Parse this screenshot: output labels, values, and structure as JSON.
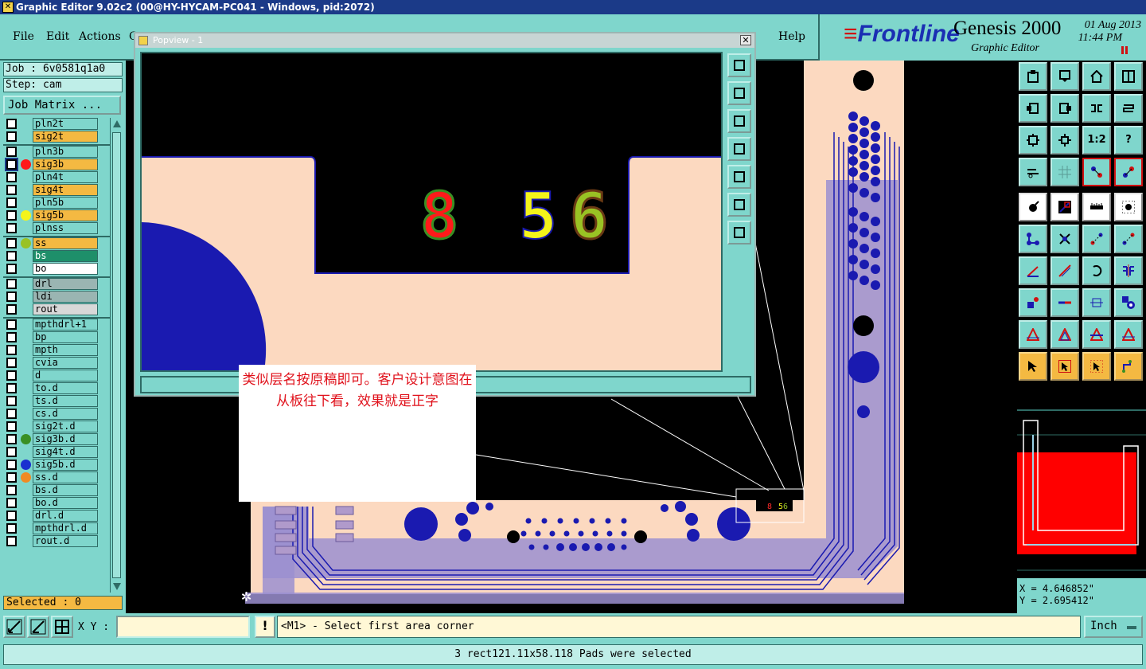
{
  "window": {
    "title": "Graphic Editor 9.02c2 (00@HY-HYCAM-PC041 - Windows, pid:2072)"
  },
  "menu": {
    "items": [
      "File",
      "Edit",
      "Actions",
      "C"
    ],
    "help": "Help"
  },
  "logo": {
    "brand": "Frontline",
    "product": "Genesis 2000",
    "subtitle": "Graphic Editor",
    "date": "01 Aug 2013",
    "time": "11:44 PM"
  },
  "job": {
    "job_label": "Job : 6v0581q1a0",
    "step_label": "Step: cam",
    "matrix_button": "Job Matrix ..."
  },
  "layers": [
    {
      "name": "pln2t",
      "color": "#7fd6cc",
      "dot": ""
    },
    {
      "name": "sig2t",
      "color": "#f4b942",
      "dot": ""
    },
    {
      "name": "pln3b",
      "color": "#7fd6cc",
      "dot": ""
    },
    {
      "name": "sig3b",
      "color": "#f4b942",
      "dot": "#ff1a1a",
      "active": true
    },
    {
      "name": "pln4t",
      "color": "#7fd6cc",
      "dot": ""
    },
    {
      "name": "sig4t",
      "color": "#f4b942",
      "dot": ""
    },
    {
      "name": "pln5b",
      "color": "#7fd6cc",
      "dot": ""
    },
    {
      "name": "sig5b",
      "color": "#f4b942",
      "dot": "#f4f41a"
    },
    {
      "name": "plnss",
      "color": "#7fd6cc",
      "dot": ""
    },
    {
      "name": "ss",
      "color": "#f4b942",
      "dot": "#99c224"
    },
    {
      "name": "bs",
      "color": "#1e8f6a",
      "dot": ""
    },
    {
      "name": "bo",
      "color": "#ffffff",
      "dot": ""
    },
    {
      "name": "drl",
      "color": "#9ab5b2",
      "dot": ""
    },
    {
      "name": "ldi",
      "color": "#9ab5b2",
      "dot": ""
    },
    {
      "name": "rout",
      "color": "#d8d8d8",
      "dot": ""
    },
    {
      "name": "mpthdrl+1",
      "color": "#7fd6cc",
      "dot": ""
    },
    {
      "name": "bp",
      "color": "#7fd6cc",
      "dot": ""
    },
    {
      "name": "mpth",
      "color": "#7fd6cc",
      "dot": ""
    },
    {
      "name": "cvia",
      "color": "#7fd6cc",
      "dot": ""
    },
    {
      "name": "d",
      "color": "#7fd6cc",
      "dot": ""
    },
    {
      "name": "to.d",
      "color": "#7fd6cc",
      "dot": ""
    },
    {
      "name": "ts.d",
      "color": "#7fd6cc",
      "dot": ""
    },
    {
      "name": "cs.d",
      "color": "#7fd6cc",
      "dot": ""
    },
    {
      "name": "sig2t.d",
      "color": "#7fd6cc",
      "dot": ""
    },
    {
      "name": "sig3b.d",
      "color": "#7fd6cc",
      "dot": "#3a8f24"
    },
    {
      "name": "sig4t.d",
      "color": "#7fd6cc",
      "dot": ""
    },
    {
      "name": "sig5b.d",
      "color": "#7fd6cc",
      "dot": "#1a2fd0"
    },
    {
      "name": "ss.d",
      "color": "#7fd6cc",
      "dot": "#f08a24"
    },
    {
      "name": "bs.d",
      "color": "#7fd6cc",
      "dot": ""
    },
    {
      "name": "bo.d",
      "color": "#7fd6cc",
      "dot": ""
    },
    {
      "name": "drl.d",
      "color": "#7fd6cc",
      "dot": ""
    },
    {
      "name": "mpthdrl.d",
      "color": "#7fd6cc",
      "dot": ""
    },
    {
      "name": "rout.d",
      "color": "#7fd6cc",
      "dot": ""
    }
  ],
  "selected": {
    "label": "Selected : 0"
  },
  "popview": {
    "title": "Popview - 1",
    "close": "✕",
    "digits": [
      "8",
      "5",
      "6"
    ]
  },
  "note": {
    "text": "类似层名按原稿即可。客户设计意图在从板往下看，效果就是正字"
  },
  "tools": {
    "row1": [
      "open-icon",
      "save-icon",
      "home-icon",
      "window-icon"
    ],
    "row2": [
      "pan-left-icon",
      "pan-right-icon",
      "swap-icon",
      "flip-icon"
    ],
    "row3": [
      "fit-icon",
      "zoom-icon",
      "scale-icon",
      "help-icon"
    ],
    "row3_label": "1:2",
    "row3_help": "?"
  },
  "coords": {
    "x": "X = 4.646852\"",
    "y": "Y = 2.695412\""
  },
  "command": {
    "xy_label": "X Y :",
    "xy_value": "",
    "excl": "!",
    "prompt": "<M1> - Select first area corner",
    "unit": "Inch"
  },
  "status": {
    "message": "3 rect121.11x58.118 Pads were selected"
  },
  "colors": {
    "accent": "#7fd6cc",
    "board": "#fcd9c0",
    "copper": "#1a1ab0",
    "highlight": "#f4b942"
  }
}
